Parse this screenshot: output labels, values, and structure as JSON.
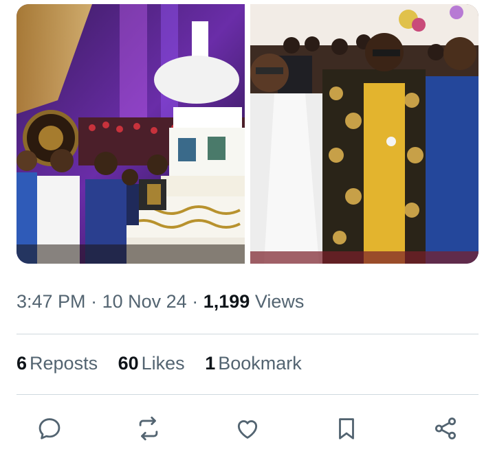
{
  "tweet": {
    "time": "3:47 PM",
    "date": "10 Nov 24",
    "views_count": "1,199",
    "views_label": "Views",
    "separator": "·"
  },
  "stats": {
    "reposts_count": "6",
    "reposts_label": "Reposts",
    "likes_count": "60",
    "likes_label": "Likes",
    "bookmarks_count": "1",
    "bookmarks_label": "Bookmark"
  },
  "actions": [
    {
      "name": "reply",
      "icon": "reply-icon"
    },
    {
      "name": "repost",
      "icon": "repost-icon"
    },
    {
      "name": "like",
      "icon": "heart-icon"
    },
    {
      "name": "bookmark",
      "icon": "bookmark-icon"
    },
    {
      "name": "share",
      "icon": "share-icon"
    }
  ],
  "colors": {
    "text_primary": "#0f1419",
    "text_secondary": "#536471",
    "divider": "#cfd9de",
    "icon": "#536471"
  }
}
